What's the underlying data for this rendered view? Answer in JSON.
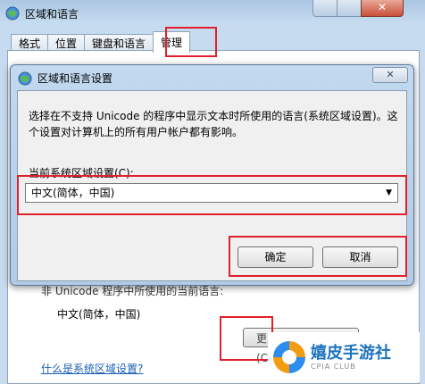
{
  "back_window": {
    "title": "区域和语言",
    "tabs": [
      {
        "label": "格式"
      },
      {
        "label": "位置"
      },
      {
        "label": "键盘和语言"
      },
      {
        "label": "管理",
        "active": true
      }
    ],
    "unicode_text": "非 Unicode 程序中所使用的当前语言:",
    "current_locale": "中文(简体，中国)",
    "change_locale_button": "更改系统区域设置(C)...",
    "what_is_link": "什么是系统区域设置?",
    "close_glyph": "✕"
  },
  "dialog": {
    "title": "区域和语言设置",
    "close_glyph": "✕",
    "description": "选择在不支持 Unicode 的程序中显示文本时所使用的语言(系统区域设置)。这个设置对计算机上的所有用户帐户都有影响。",
    "locale_label": "当前系统区域设置(C):",
    "locale_value": "中文(简体，中国)",
    "ok_label": "确定",
    "cancel_label": "取消"
  },
  "watermark": {
    "brand": "嬉皮手游社",
    "sub": "CPIA CLUB"
  },
  "colors": {
    "highlight": "#e0202c",
    "link": "#1a5fb4"
  }
}
